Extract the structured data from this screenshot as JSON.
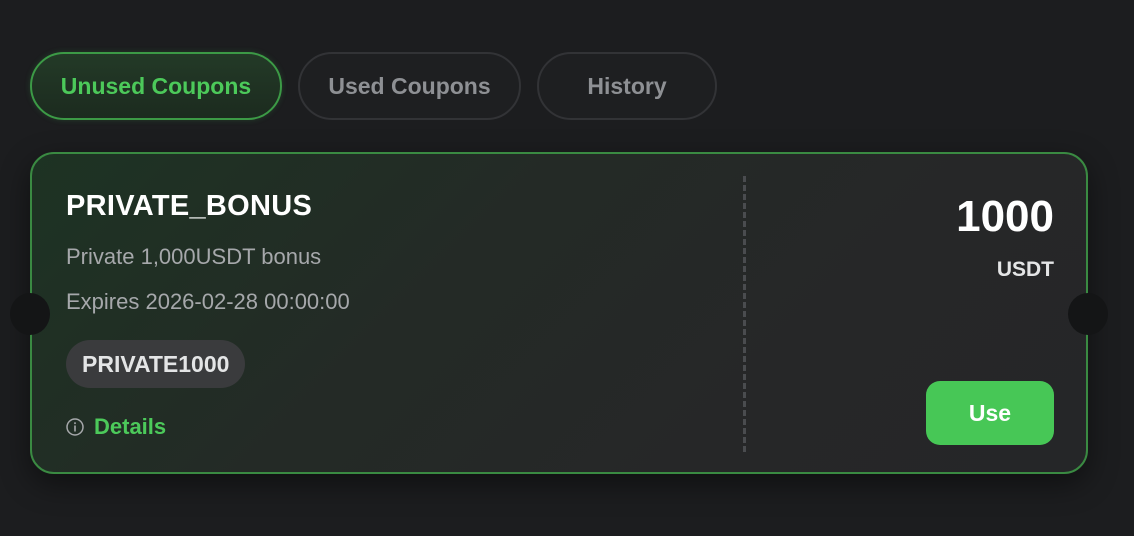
{
  "tabs": [
    {
      "label": "Unused Coupons",
      "active": true
    },
    {
      "label": "Used Coupons",
      "active": false
    },
    {
      "label": "History",
      "active": false
    }
  ],
  "coupon": {
    "title": "PRIVATE_BONUS",
    "description": "Private 1,000USDT bonus",
    "expiry": "Expires 2026-02-28 00:00:00",
    "code": "PRIVATE1000",
    "details_label": "Details",
    "details_icon": "info-icon",
    "amount": "1000",
    "currency": "USDT",
    "use_label": "Use"
  },
  "colors": {
    "accent": "#4cc95a",
    "button": "#47c756",
    "background": "#1c1d1f",
    "card_border": "#3a8a42"
  }
}
